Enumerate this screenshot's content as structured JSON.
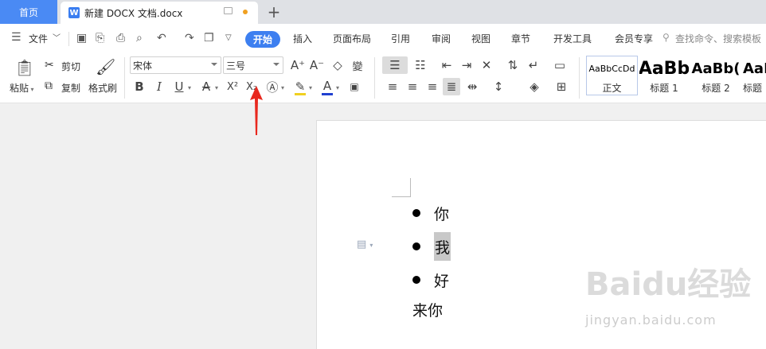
{
  "tabs": {
    "home": "首页",
    "doc_title": "新建 DOCX 文档.docx",
    "new_tab": "+"
  },
  "menu": {
    "file": "文件",
    "items": [
      "开始",
      "插入",
      "页面布局",
      "引用",
      "审阅",
      "视图",
      "章节",
      "开发工具",
      "会员专享"
    ],
    "search_placeholder": "查找命令、搜索模板"
  },
  "ribbon": {
    "paste": "粘贴",
    "cut": "剪切",
    "copy": "复制",
    "format_painter": "格式刷",
    "font_name": "宋体",
    "font_size": "三号",
    "bold": "B",
    "italic": "I",
    "underline": "U",
    "superscript": "X²",
    "subscript": "X₂",
    "font_color": "A",
    "styles": [
      {
        "sample": "AaBbCcDd",
        "name": "正文"
      },
      {
        "sample": "AaBb",
        "name": "标题 1"
      },
      {
        "sample": "AaBb(",
        "name": "标题 2"
      },
      {
        "sample": "AaB",
        "name": "标题"
      }
    ]
  },
  "document": {
    "bullets": [
      "你",
      "我",
      "好"
    ],
    "selected_index": 1,
    "plain_line": "来你"
  },
  "watermark": {
    "main": "Baidu经验",
    "sub": "jingyan.baidu.com"
  },
  "colors": {
    "accent": "#3d7ff0",
    "home_tab": "#4a8af4",
    "arrow": "#e8281e",
    "font_color_bar": "#2040d0",
    "highlight_bar": "#f0d020"
  }
}
